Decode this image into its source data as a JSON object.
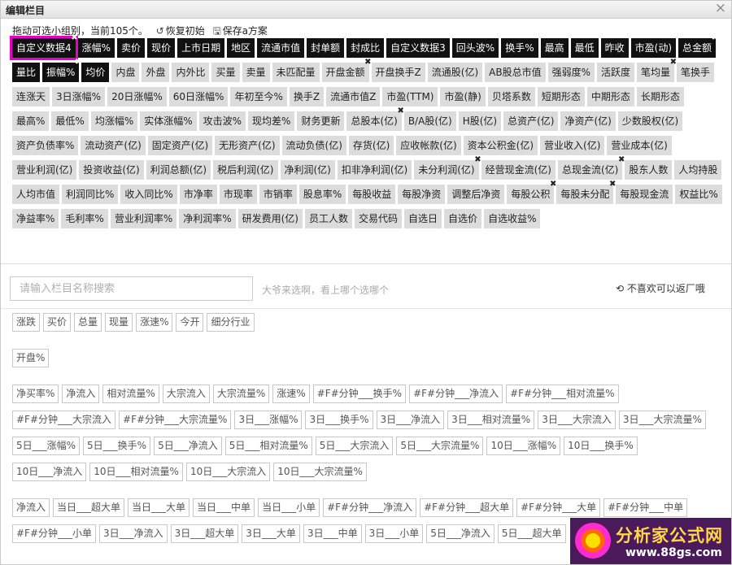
{
  "window": {
    "title": "编辑栏目"
  },
  "hint": {
    "text": "拖动可选小组别，当前105个。",
    "restore": "恢复初始",
    "save": "保存a方案"
  },
  "selected": [
    {
      "label": "自定义数据4",
      "style": "dark",
      "x": true,
      "highlight": true
    },
    {
      "label": "涨幅%",
      "style": "dark"
    },
    {
      "label": "卖价",
      "style": "dark"
    },
    {
      "label": "现价",
      "style": "dark"
    },
    {
      "label": "上市日期",
      "style": "dark"
    },
    {
      "label": "地区",
      "style": "dark"
    },
    {
      "label": "流通市值",
      "style": "dark"
    },
    {
      "label": "封单额",
      "style": "dark"
    },
    {
      "label": "封成比",
      "style": "dark"
    },
    {
      "label": "自定义数据3",
      "style": "dark"
    },
    {
      "label": "回头波%",
      "style": "dark"
    },
    {
      "label": "换手%",
      "style": "dark"
    },
    {
      "label": "最高",
      "style": "dark"
    },
    {
      "label": "最低",
      "style": "dark"
    },
    {
      "label": "昨收",
      "style": "dark"
    },
    {
      "label": "市盈(动)",
      "style": "dark"
    },
    {
      "label": "总金额",
      "style": "dark",
      "x": true
    },
    {
      "label": "量比",
      "style": "dark"
    },
    {
      "label": "振幅%",
      "style": "dark",
      "x": true
    },
    {
      "label": "均价",
      "style": "dark"
    },
    {
      "label": "内盘",
      "style": "light"
    },
    {
      "label": "外盘",
      "style": "light"
    },
    {
      "label": "内外比",
      "style": "light"
    },
    {
      "label": "买量",
      "style": "light"
    },
    {
      "label": "卖量",
      "style": "light"
    },
    {
      "label": "未匹配量",
      "style": "light"
    },
    {
      "label": "开盘金额",
      "style": "light",
      "x": true
    },
    {
      "label": "开盘换手Z",
      "style": "light"
    },
    {
      "label": "流通股(亿)",
      "style": "light"
    },
    {
      "label": "AB股总市值",
      "style": "light"
    },
    {
      "label": "强弱度%",
      "style": "light"
    },
    {
      "label": "活跃度",
      "style": "light"
    },
    {
      "label": "笔均量",
      "style": "light",
      "x": true
    },
    {
      "label": "笔换手",
      "style": "light"
    },
    {
      "label": "连涨天",
      "style": "light"
    },
    {
      "label": "3日涨幅%",
      "style": "light"
    },
    {
      "label": "20日涨幅%",
      "style": "light"
    },
    {
      "label": "60日涨幅%",
      "style": "light"
    },
    {
      "label": "年初至今%",
      "style": "light"
    },
    {
      "label": "换手Z",
      "style": "light"
    },
    {
      "label": "流通市值Z",
      "style": "light"
    },
    {
      "label": "市盈(TTM)",
      "style": "light"
    },
    {
      "label": "市盈(静)",
      "style": "light"
    },
    {
      "label": "贝塔系数",
      "style": "light"
    },
    {
      "label": "短期形态",
      "style": "light"
    },
    {
      "label": "中期形态",
      "style": "light"
    },
    {
      "label": "长期形态",
      "style": "light"
    },
    {
      "label": "最高%",
      "style": "light"
    },
    {
      "label": "最低%",
      "style": "light"
    },
    {
      "label": "均涨幅%",
      "style": "light"
    },
    {
      "label": "实体涨幅%",
      "style": "light"
    },
    {
      "label": "攻击波%",
      "style": "light"
    },
    {
      "label": "现均差%",
      "style": "light"
    },
    {
      "label": "财务更新",
      "style": "light"
    },
    {
      "label": "总股本(亿)",
      "style": "light",
      "x": true
    },
    {
      "label": "B/A股(亿)",
      "style": "light"
    },
    {
      "label": "H股(亿)",
      "style": "light"
    },
    {
      "label": "总资产(亿)",
      "style": "light"
    },
    {
      "label": "净资产(亿)",
      "style": "light"
    },
    {
      "label": "少数股权(亿)",
      "style": "light"
    },
    {
      "label": "资产负债率%",
      "style": "light"
    },
    {
      "label": "流动资产(亿)",
      "style": "light"
    },
    {
      "label": "固定资产(亿)",
      "style": "light"
    },
    {
      "label": "无形资产(亿)",
      "style": "light"
    },
    {
      "label": "流动负债(亿)",
      "style": "light"
    },
    {
      "label": "存货(亿)",
      "style": "light"
    },
    {
      "label": "应收帐款(亿)",
      "style": "light"
    },
    {
      "label": "资本公积金(亿)",
      "style": "light"
    },
    {
      "label": "营业收入(亿)",
      "style": "light"
    },
    {
      "label": "营业成本(亿)",
      "style": "light"
    },
    {
      "label": "营业利润(亿)",
      "style": "light"
    },
    {
      "label": "投资收益(亿)",
      "style": "light"
    },
    {
      "label": "利润总额(亿)",
      "style": "light"
    },
    {
      "label": "税后利润(亿)",
      "style": "light"
    },
    {
      "label": "净利润(亿)",
      "style": "light"
    },
    {
      "label": "扣非净利润(亿)",
      "style": "light"
    },
    {
      "label": "未分利润(亿)",
      "style": "light",
      "x": true
    },
    {
      "label": "经营现金流(亿)",
      "style": "light"
    },
    {
      "label": "总现金流(亿)",
      "style": "light",
      "x": true
    },
    {
      "label": "股东人数",
      "style": "light"
    },
    {
      "label": "人均持股",
      "style": "light"
    },
    {
      "label": "人均市值",
      "style": "light"
    },
    {
      "label": "利润同比%",
      "style": "light"
    },
    {
      "label": "收入同比%",
      "style": "light"
    },
    {
      "label": "市净率",
      "style": "light"
    },
    {
      "label": "市现率",
      "style": "light"
    },
    {
      "label": "市销率",
      "style": "light"
    },
    {
      "label": "股息率%",
      "style": "light"
    },
    {
      "label": "每股收益",
      "style": "light"
    },
    {
      "label": "每股净资",
      "style": "light"
    },
    {
      "label": "调整后净资",
      "style": "light"
    },
    {
      "label": "每股公积",
      "style": "light",
      "x": true
    },
    {
      "label": "每股未分配",
      "style": "light",
      "x": true
    },
    {
      "label": "每股现金流",
      "style": "light"
    },
    {
      "label": "权益比%",
      "style": "light"
    },
    {
      "label": "净益率%",
      "style": "light"
    },
    {
      "label": "毛利率%",
      "style": "light"
    },
    {
      "label": "营业利润率%",
      "style": "light"
    },
    {
      "label": "净利润率%",
      "style": "light"
    },
    {
      "label": "研发费用(亿)",
      "style": "light"
    },
    {
      "label": "员工人数",
      "style": "light"
    },
    {
      "label": "交易代码",
      "style": "light"
    },
    {
      "label": "自选日",
      "style": "light"
    },
    {
      "label": "自选价",
      "style": "light"
    },
    {
      "label": "自选收益%",
      "style": "light"
    }
  ],
  "search": {
    "placeholder": "请输入栏目名称搜索",
    "tip": "大爷来选啊，看上哪个选哪个",
    "reset": "不喜欢可以返厂哦"
  },
  "available_rows": [
    [
      "涨跌",
      "买价",
      "总量",
      "现量",
      "涨速%",
      "今开",
      "细分行业"
    ],
    [
      "开盘%"
    ],
    [
      "净买率%",
      "净流入",
      "相对流量%",
      "大宗流入",
      "大宗流量%",
      "涨速%",
      "#F#分钟___换手%",
      "#F#分钟___净流入",
      "#F#分钟___相对流量%"
    ],
    [
      "#F#分钟___大宗流入",
      "#F#分钟___大宗流量%",
      "3日___涨幅%",
      "3日___换手%",
      "3日___净流入",
      "3日___相对流量%",
      "3日___大宗流入",
      "3日___大宗流量%"
    ],
    [
      "5日___涨幅%",
      "5日___换手%",
      "5日___净流入",
      "5日___相对流量%",
      "5日___大宗流入",
      "5日___大宗流量%",
      "10日___涨幅%",
      "10日___换手%"
    ],
    [
      "10日___净流入",
      "10日___相对流量%",
      "10日___大宗流入",
      "10日___大宗流量%"
    ],
    [
      "净流入",
      "当日___超大单",
      "当日___大单",
      "当日___中单",
      "当日___小单",
      "#F#分钟___净流入",
      "#F#分钟___超大单",
      "#F#分钟___大单",
      "#F#分钟___中单"
    ],
    [
      "#F#分钟___小单",
      "3日___净流入",
      "3日___超大单",
      "3日___大单",
      "3日___中单",
      "3日___小单",
      "5日___净流入",
      "5日___超大单"
    ]
  ],
  "watermark": {
    "title": "分析家公式网",
    "url": "www.88gs.com"
  },
  "colors": {
    "selected_dark": "#111111",
    "selected_light": "#dcdcdc",
    "highlight": "#e600c8"
  }
}
